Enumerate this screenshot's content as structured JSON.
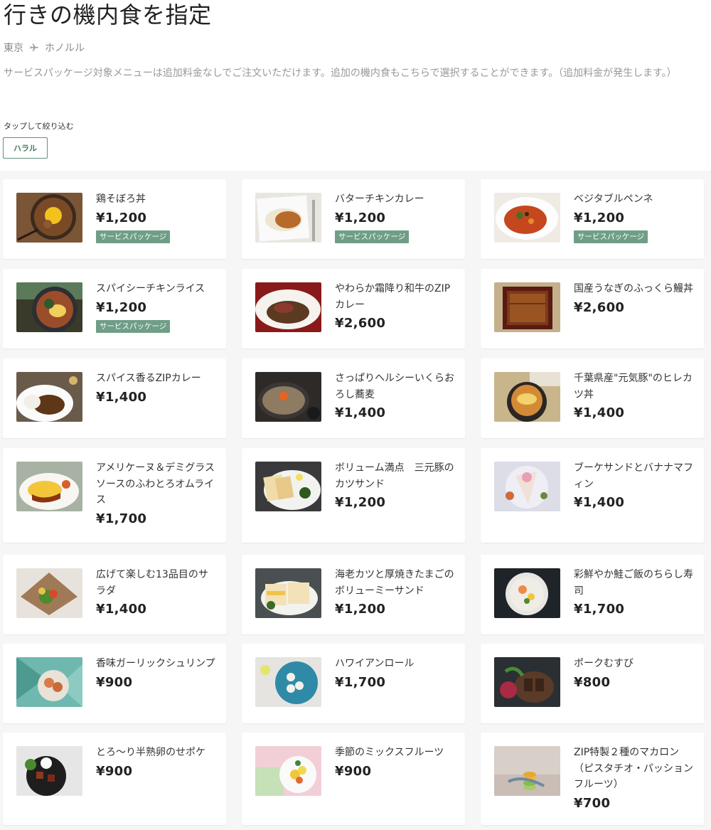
{
  "header": {
    "title": "行きの機内食を指定",
    "route_from": "東京",
    "route_to": "ホノルル",
    "description": "サービスパッケージ対象メニューは追加料金なしでご注文いただけます。追加の機内食もこちらで選択することができます。（追加料金が発生します。）"
  },
  "filter": {
    "label": "タップして絞り込む",
    "chip": "ハラル"
  },
  "colors": {
    "accent": "#5b9278",
    "badge": "#6f9e87"
  },
  "meals": [
    {
      "name": "鶏そぼろ丼",
      "price": "¥1,200",
      "badge": "サービスパッケージ"
    },
    {
      "name": "バターチキンカレー",
      "price": "¥1,200",
      "badge": "サービスパッケージ"
    },
    {
      "name": "ベジタブルペンネ",
      "price": "¥1,200",
      "badge": "サービスパッケージ"
    },
    {
      "name": "スパイシーチキンライス",
      "price": "¥1,200",
      "badge": "サービスパッケージ"
    },
    {
      "name": "やわらか霜降り和牛のZIPカレー",
      "price": "¥2,600",
      "badge": ""
    },
    {
      "name": "国産うなぎのふっくら鰻丼",
      "price": "¥2,600",
      "badge": ""
    },
    {
      "name": "スパイス香るZIPカレー",
      "price": "¥1,400",
      "badge": ""
    },
    {
      "name": "さっぱりヘルシーいくらおろし蕎麦",
      "price": "¥1,400",
      "badge": ""
    },
    {
      "name": "千葉県産\"元気豚\"のヒレカツ丼",
      "price": "¥1,400",
      "badge": ""
    },
    {
      "name": "アメリケーヌ＆デミグラスソースのふわとろオムライス",
      "price": "¥1,700",
      "badge": ""
    },
    {
      "name": "ボリューム満点　三元豚のカツサンド",
      "price": "¥1,200",
      "badge": ""
    },
    {
      "name": "ブーケサンドとバナナマフィン",
      "price": "¥1,400",
      "badge": ""
    },
    {
      "name": "広げて楽しむ13品目のサラダ",
      "price": "¥1,400",
      "badge": ""
    },
    {
      "name": "海老カツと厚焼きたまごのボリューミーサンド",
      "price": "¥1,200",
      "badge": ""
    },
    {
      "name": "彩鮮やか鮭ご飯のちらし寿司",
      "price": "¥1,700",
      "badge": ""
    },
    {
      "name": "香味ガーリックシュリンプ",
      "price": "¥900",
      "badge": ""
    },
    {
      "name": "ハワイアンロール",
      "price": "¥1,700",
      "badge": ""
    },
    {
      "name": "ポークむすび",
      "price": "¥800",
      "badge": ""
    },
    {
      "name": "とろ〜り半熟卵のせポケ",
      "price": "¥900",
      "badge": ""
    },
    {
      "name": "季節のミックスフルーツ",
      "price": "¥900",
      "badge": ""
    },
    {
      "name": "ZIP特製２種のマカロン（ピスタチオ・パッションフルーツ）",
      "price": "¥700",
      "badge": ""
    }
  ]
}
